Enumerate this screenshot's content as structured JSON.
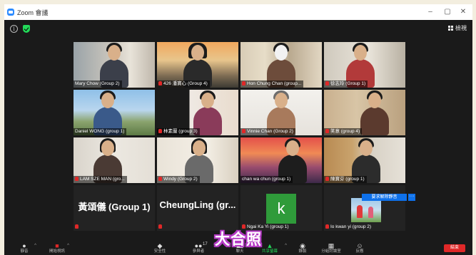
{
  "window": {
    "title": "Zoom 會議"
  },
  "window_controls": [
    "–",
    "▢",
    "✕"
  ],
  "topbar": {
    "view_label": "檢視",
    "info_glyph": "i"
  },
  "participants": [
    {
      "name": "Mary Chow (Group 2)",
      "muted": false
    },
    {
      "name": "426 潘寶心 (Group 4)",
      "muted": true
    },
    {
      "name": "Hon Chung Chan (group...",
      "muted": true
    },
    {
      "name": "徐志玲 (Group 1)",
      "muted": true
    },
    {
      "name": "Daniel WONG (group 1)",
      "muted": false,
      "speaking": true
    },
    {
      "name": "林素蘭 (group 3)",
      "muted": true
    },
    {
      "name": "Vinnie Chan (Group 2)",
      "muted": true
    },
    {
      "name": "笑意 (group 4)",
      "muted": true
    },
    {
      "name": "LAM SZE MAN (gro...",
      "muted": true
    },
    {
      "name": "Windy (Group 2)",
      "muted": true
    },
    {
      "name": "chan wa chun (group 1)",
      "muted": true
    },
    {
      "name": "陳寶芬 (group 1)",
      "muted": true
    },
    {
      "name": "",
      "display_name": "黃頌儀 (Group 1)",
      "muted": true
    },
    {
      "name": "",
      "display_name": "CheungLing (gr...",
      "muted": true
    },
    {
      "name": "Ngai Ka Yi (group 1)",
      "muted": true,
      "avatar_letter": "k"
    },
    {
      "name": "Io kwan yi (group 2)",
      "muted": true
    }
  ],
  "overlay": {
    "unmute_request": "要求解除靜音",
    "more_glyph": "···"
  },
  "toolbar": {
    "items": [
      {
        "label": "靜音",
        "icon": "mic-icon",
        "glyph": "🎤"
      },
      {
        "label": "開始視訊",
        "icon": "video-off-icon",
        "glyph": "▶"
      },
      {
        "label": "安全性",
        "icon": "shield-icon",
        "glyph": "⛨"
      },
      {
        "label": "參與者",
        "icon": "participants-icon",
        "glyph": "👥",
        "count": "17"
      },
      {
        "label": "聊天",
        "icon": "chat-icon",
        "glyph": "💬"
      },
      {
        "label": "共享螢幕",
        "icon": "share-screen-icon",
        "glyph": "⬆"
      },
      {
        "label": "錄製",
        "icon": "record-icon",
        "glyph": "◉"
      },
      {
        "label": "分組討論室",
        "icon": "breakout-rooms-icon",
        "glyph": "▦"
      },
      {
        "label": "反應",
        "icon": "reactions-icon",
        "glyph": "☺"
      }
    ],
    "end_label": "結束"
  },
  "caption": {
    "text": "大合照"
  },
  "colors": {
    "accent": "#0e71eb",
    "speaker_border": "#f6d232",
    "end": "#e02828",
    "caption_outline": "#b43ac4"
  }
}
